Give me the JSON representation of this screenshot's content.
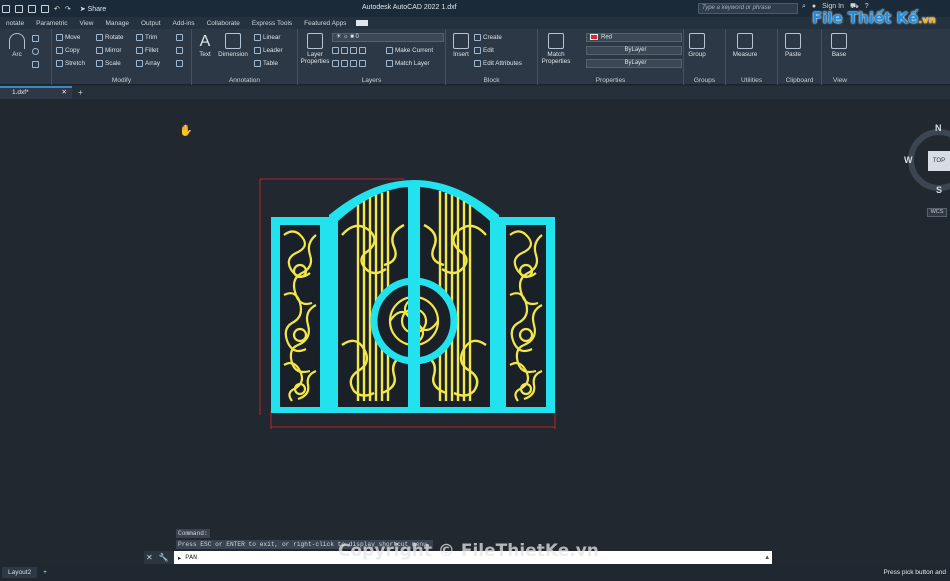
{
  "window": {
    "title": "Autodesk AutoCAD 2022  1.dxf",
    "share_label": "Share",
    "search_placeholder": "Type a keyword or phrase",
    "sign_in": "Sign In"
  },
  "ribbon_tabs": [
    "notate",
    "Parametric",
    "View",
    "Manage",
    "Output",
    "Add-ins",
    "Collaborate",
    "Express Tools",
    "Featured Apps"
  ],
  "ribbon": {
    "draw": {
      "arc": "Arc"
    },
    "modify": {
      "title": "Modify",
      "move": "Move",
      "rotate": "Rotate",
      "trim": "Trim",
      "copy": "Copy",
      "mirror": "Mirror",
      "fillet": "Fillet",
      "stretch": "Stretch",
      "scale": "Scale",
      "array": "Array"
    },
    "annotation": {
      "title": "Annotation",
      "text": "Text",
      "dimension": "Dimension",
      "linear": "Linear",
      "leader": "Leader",
      "table": "Table"
    },
    "layers": {
      "title": "Layers",
      "layer_properties": "Layer Properties",
      "current_layer": "0",
      "make_current": "Make Current",
      "match_layer": "Match Layer"
    },
    "block": {
      "title": "Block",
      "insert": "Insert",
      "create": "Create",
      "edit": "Edit",
      "edit_attributes": "Edit Attributes"
    },
    "properties": {
      "title": "Properties",
      "match_properties": "Match Properties",
      "color": "Red",
      "linetype": "ByLayer",
      "lineweight": "ByLayer",
      "color_hex": "#e0262b"
    },
    "groups": {
      "title": "Groups",
      "group": "Group"
    },
    "utilities": {
      "title": "Utilities",
      "measure": "Measure"
    },
    "clipboard": {
      "title": "Clipboard",
      "paste": "Paste"
    },
    "view": {
      "title": "View",
      "base": "Base"
    }
  },
  "document_tab": {
    "name": "1.dxf*"
  },
  "viewcube": {
    "north": "N",
    "south": "S",
    "west": "W",
    "top": "TOP",
    "wcs": "WCS"
  },
  "command": {
    "history_1": "Command:",
    "history_2": "Press ESC or ENTER to exit, or right-click to display shortcut menu.",
    "current": "PAN"
  },
  "status": {
    "layout_tab": "Layout2",
    "message": "Press pick button and"
  },
  "watermark": {
    "logo_main": "File Thiết Kế",
    "logo_suffix": ".vn",
    "center": "Copyright © FileThietKe.vn"
  },
  "colors": {
    "gate_frame": "#22e2ee",
    "gate_ornament": "#f1e64a",
    "dimension": "#e0262b",
    "canvas_bg": "#212830"
  }
}
